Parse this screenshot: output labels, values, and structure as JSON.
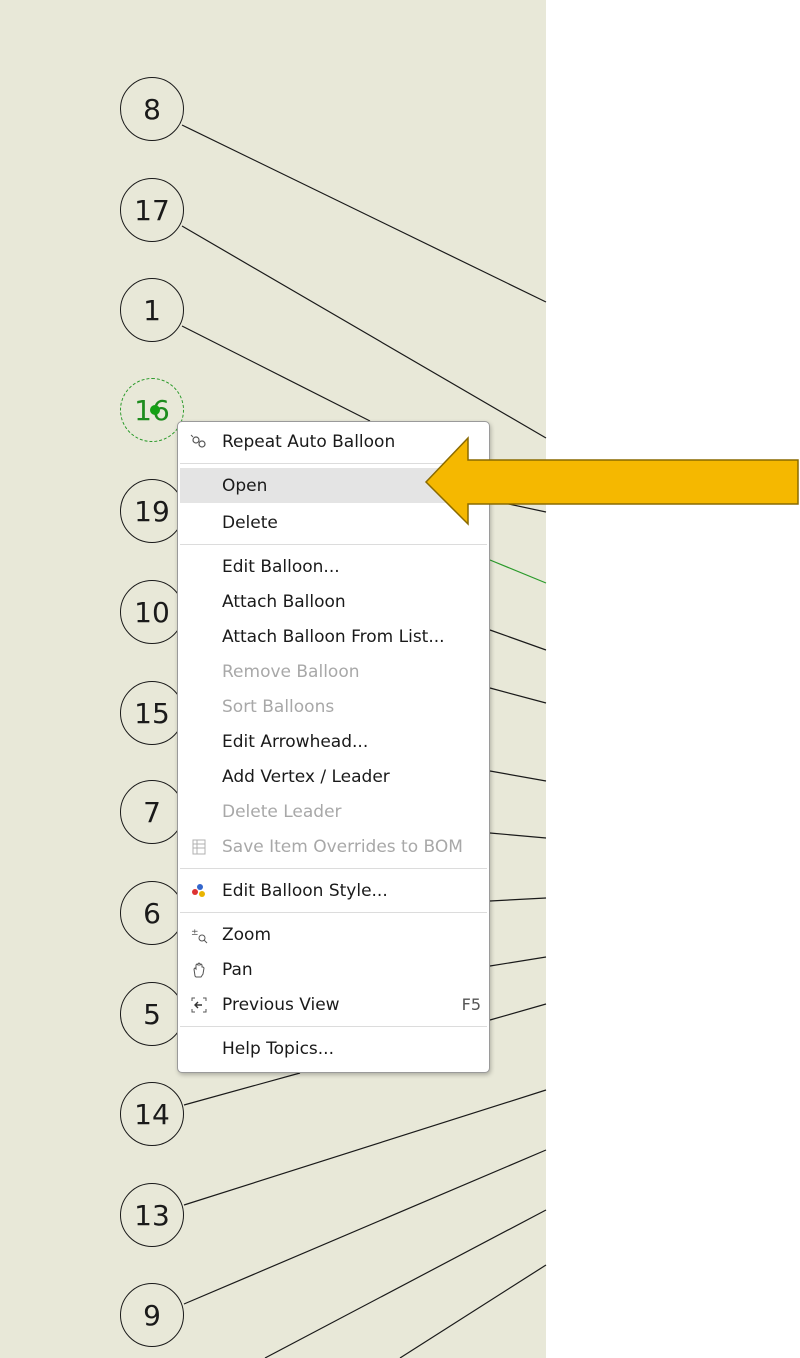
{
  "drawing": {
    "balloons": [
      {
        "label": "8",
        "selected": false
      },
      {
        "label": "17",
        "selected": false
      },
      {
        "label": "1",
        "selected": false
      },
      {
        "label": "16",
        "selected": true
      },
      {
        "label": "19",
        "selected": false
      },
      {
        "label": "10",
        "selected": false
      },
      {
        "label": "15",
        "selected": false
      },
      {
        "label": "7",
        "selected": false
      },
      {
        "label": "6",
        "selected": false
      },
      {
        "label": "5",
        "selected": false
      },
      {
        "label": "14",
        "selected": false
      },
      {
        "label": "13",
        "selected": false
      },
      {
        "label": "9",
        "selected": false
      }
    ]
  },
  "context_menu": {
    "items": [
      {
        "label": "Repeat Auto Balloon",
        "icon": "auto-balloon-icon",
        "enabled": true
      },
      {
        "label": "Open",
        "enabled": true,
        "hover": true
      },
      {
        "label": "Delete",
        "enabled": true
      },
      {
        "label": "Edit Balloon...",
        "enabled": true
      },
      {
        "label": "Attach Balloon",
        "enabled": true
      },
      {
        "label": "Attach Balloon From List...",
        "enabled": true
      },
      {
        "label": "Remove Balloon",
        "enabled": false
      },
      {
        "label": "Sort Balloons",
        "enabled": false
      },
      {
        "label": "Edit Arrowhead...",
        "enabled": true
      },
      {
        "label": "Add Vertex / Leader",
        "enabled": true
      },
      {
        "label": "Delete Leader",
        "enabled": false
      },
      {
        "label": "Save Item Overrides to BOM",
        "icon": "table-icon",
        "enabled": false
      },
      {
        "label": "Edit Balloon Style...",
        "icon": "style-icon",
        "enabled": true
      },
      {
        "label": "Zoom",
        "icon": "zoom-icon",
        "enabled": true
      },
      {
        "label": "Pan",
        "icon": "hand-icon",
        "enabled": true
      },
      {
        "label": "Previous View",
        "icon": "previous-view-icon",
        "enabled": true,
        "shortcut": "F5"
      },
      {
        "label": "Help Topics...",
        "enabled": true
      }
    ]
  },
  "colors": {
    "sheet_background": "#e8e8d8",
    "selection_green": "#1e8c1e",
    "callout_arrow": "#f5b800"
  }
}
